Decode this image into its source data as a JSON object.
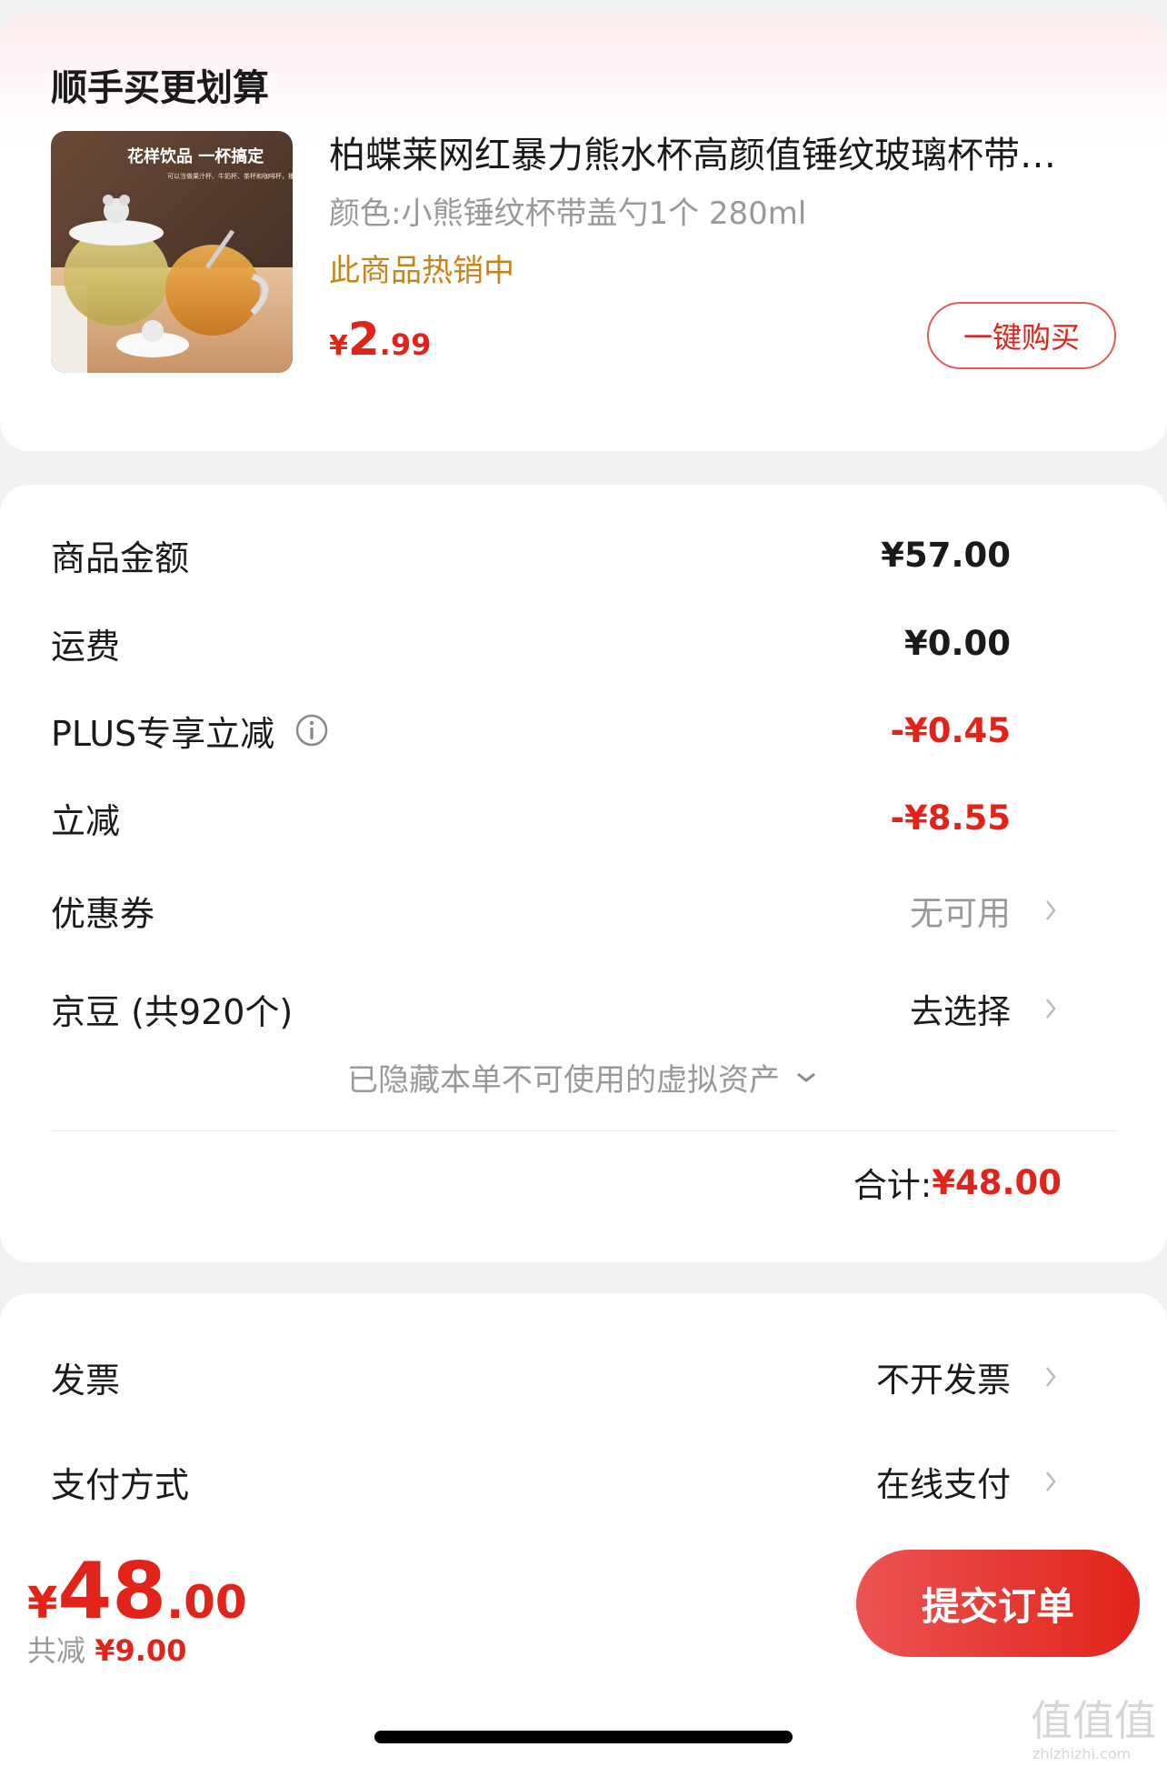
{
  "addon": {
    "title": "顺手买更划算",
    "product": {
      "image_caption": "花样饮品 一杯搞定",
      "image_subtext": "可以当做果汁杯、牛奶杯、茶杯和咖啡杯，播相有颜值，让生活上镜",
      "name": "柏蝶莱网红暴力熊水杯高颜值锤纹玻璃杯带…",
      "spec": "颜色:小熊锤纹杯带盖勺1个 280ml",
      "hot": "此商品热销中",
      "price_currency": "¥",
      "price_int": "2",
      "price_dec": ".99",
      "buy_label": "一键购买"
    }
  },
  "summary": {
    "rows": [
      {
        "label": "商品金额",
        "value": "¥57.00"
      },
      {
        "label": "运费",
        "value": "¥0.00"
      },
      {
        "label": "PLUS专享立减",
        "value": "-¥0.45"
      },
      {
        "label": "立减",
        "value": "-¥8.55"
      },
      {
        "label": "优惠券",
        "value": "无可用"
      },
      {
        "label": "京豆 (共920个)",
        "value": "去选择"
      }
    ],
    "hidden_note": "已隐藏本单不可使用的虚拟资产",
    "total_label": "合计:",
    "total_value": "¥48.00"
  },
  "other": {
    "rows": [
      {
        "label": "发票",
        "value": "不开发票"
      },
      {
        "label": "支付方式",
        "value": "在线支付"
      }
    ]
  },
  "bottom": {
    "currency": "¥",
    "amount_int": "48",
    "amount_dec": ".00",
    "saved_label": "共减",
    "saved_value": "¥9.00",
    "submit_label": "提交订单"
  },
  "colors": {
    "accent": "#e2231a",
    "hot": "#c8831a",
    "muted": "#999999"
  },
  "watermark": "值值值 zhizhizhi.com"
}
